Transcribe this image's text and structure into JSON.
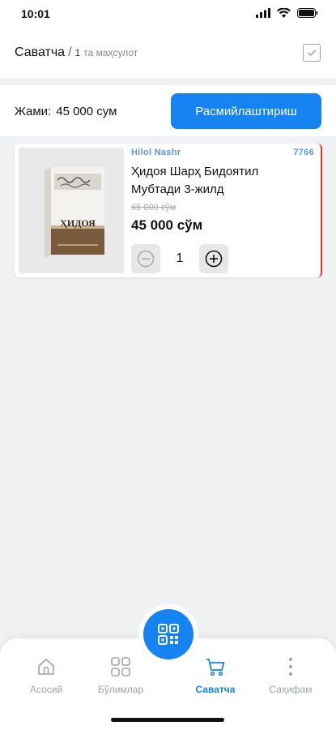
{
  "status": {
    "time": "10:01"
  },
  "header": {
    "title": "Саватча",
    "separator": "/",
    "count": "1",
    "unit": "та маҳсулот"
  },
  "total": {
    "label": "Жами:",
    "amount": "45 000 сум",
    "checkout_label": "Расмийлаштириш"
  },
  "cart": {
    "items": [
      {
        "publisher": "Hilol Nashr",
        "code": "7766",
        "title": "Ҳидоя Шарҳ Бидоятил Мубтади 3-жилд",
        "old_price": "65 000 сўм",
        "price": "45 000 сўм",
        "quantity": "1",
        "cover_text": "ҲИДОЯ"
      }
    ]
  },
  "nav": {
    "items": [
      {
        "label": "Асосий",
        "icon": "home-icon",
        "active": false
      },
      {
        "label": "Бўлимлар",
        "icon": "grid-icon",
        "active": false
      },
      {
        "label": "Саватча",
        "icon": "cart-icon",
        "active": true
      },
      {
        "label": "Саҳифам",
        "icon": "more-vertical-icon",
        "active": false
      }
    ]
  },
  "colors": {
    "accent": "#1584f2",
    "publisher": "#5a96e6",
    "item_border": "#e53935",
    "background": "#f0f1f2"
  }
}
